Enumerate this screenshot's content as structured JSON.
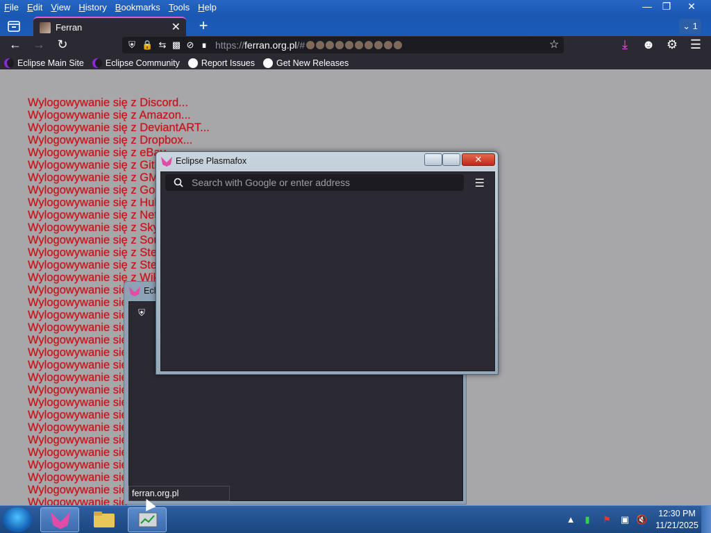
{
  "menubar": [
    {
      "label": "File",
      "key": "F",
      "rest": "ile"
    },
    {
      "label": "Edit",
      "key": "E",
      "rest": "dit"
    },
    {
      "label": "View",
      "key": "V",
      "rest": "iew"
    },
    {
      "label": "History",
      "key": "H",
      "rest": "istory"
    },
    {
      "label": "Bookmarks",
      "key": "B",
      "rest": "ookmarks"
    },
    {
      "label": "Tools",
      "key": "T",
      "rest": "ools"
    },
    {
      "label": "Help",
      "key": "H",
      "rest": "elp"
    }
  ],
  "tab": {
    "title": "Ferran",
    "close": "✕"
  },
  "tab_counter": "1",
  "url": {
    "scheme": "https://",
    "host": "ferran.org.pl",
    "path": "/#"
  },
  "bookmarks": [
    {
      "label": "Eclipse Main Site",
      "icon": "moon"
    },
    {
      "label": "Eclipse Community",
      "icon": "moon"
    },
    {
      "label": "Report Issues",
      "icon": "github"
    },
    {
      "label": "Get New Releases",
      "icon": "github"
    }
  ],
  "logout_lines": [
    "Wylogowywanie się z Discord...",
    "Wylogowywanie się z Amazon...",
    "Wylogowywanie się z DeviantART...",
    "Wylogowywanie się z Dropbox...",
    "Wylogowywanie się z eBay...",
    "Wylogowywanie się z GitHub...",
    "Wylogowywanie się z GMail...",
    "Wylogowywanie się z Google...",
    "Wylogowywanie się z Hulu...",
    "Wylogowywanie się z Netflix...",
    "Wylogowywanie się z Skype...",
    "Wylogowywanie się z SoundCloud...",
    "Wylogowywanie się z Steam...",
    "Wylogowywanie się z Steam...",
    "Wylogowywanie się z Wikipedia...",
    "Wylogowywanie się",
    "Wylogowywanie się",
    "Wylogowywanie się",
    "Wylogowywanie się",
    "Wylogowywanie się",
    "Wylogowywanie się",
    "Wylogowywanie się",
    "Wylogowywanie się",
    "Wylogowywanie się",
    "Wylogowywanie się",
    "Wylogowywanie się",
    "Wylogowywanie się",
    "Wylogowywanie się",
    "Wylogowywanie się",
    "Wylogowywanie się",
    "Wylogowywanie się",
    "Wylogowywanie się",
    "Wylogowywanie się",
    "Wylogowywanie się"
  ],
  "back_window": {
    "title": "Ecli",
    "status_url": "ferran.org.pl"
  },
  "front_window": {
    "title": "Eclipse Plasmafox",
    "search_placeholder": "Search with Google or enter address",
    "close": "✕"
  },
  "taskbar": {
    "time": "12:30 PM",
    "date": "11/21/2025"
  },
  "colors": {
    "accent": "#e95ad6",
    "logout_text": "#c1121b",
    "page_bg": "#a7a6a8",
    "chrome_bg": "#2b2a33"
  }
}
